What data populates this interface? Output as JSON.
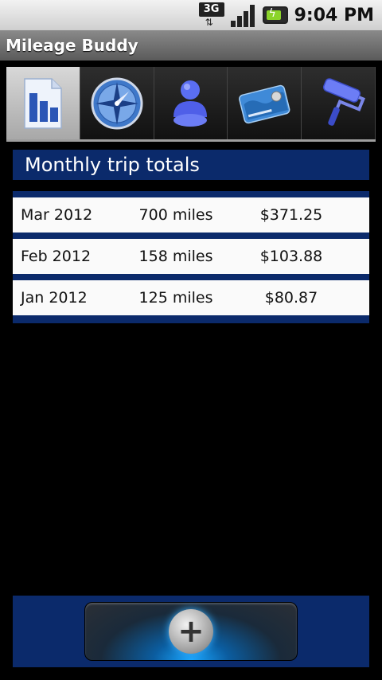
{
  "status_bar": {
    "network_label": "3G",
    "time": "9:04 PM",
    "icons": [
      "3g-network-icon",
      "signal-strength-icon",
      "battery-charging-icon"
    ]
  },
  "app": {
    "title": "Mileage Buddy"
  },
  "tabs": [
    {
      "name": "reports",
      "icon": "bar-chart-document-icon",
      "selected": true
    },
    {
      "name": "compass",
      "icon": "compass-icon",
      "selected": false
    },
    {
      "name": "profile",
      "icon": "person-icon",
      "selected": false
    },
    {
      "name": "payment",
      "icon": "credit-card-icon",
      "selected": false
    },
    {
      "name": "theme",
      "icon": "paint-roller-icon",
      "selected": false
    }
  ],
  "section": {
    "title": "Monthly trip totals"
  },
  "totals": [
    {
      "month": "Mar 2012",
      "miles": "700 miles",
      "cost": "$371.25"
    },
    {
      "month": "Feb 2012",
      "miles": "158 miles",
      "cost": "$103.88"
    },
    {
      "month": "Jan 2012",
      "miles": "125 miles",
      "cost": "$80.87"
    }
  ],
  "actions": {
    "add_icon": "plus-icon",
    "add_glyph": "+"
  },
  "colors": {
    "accent": "#0b2a6b",
    "tab_selected": "#c8c8c8"
  }
}
